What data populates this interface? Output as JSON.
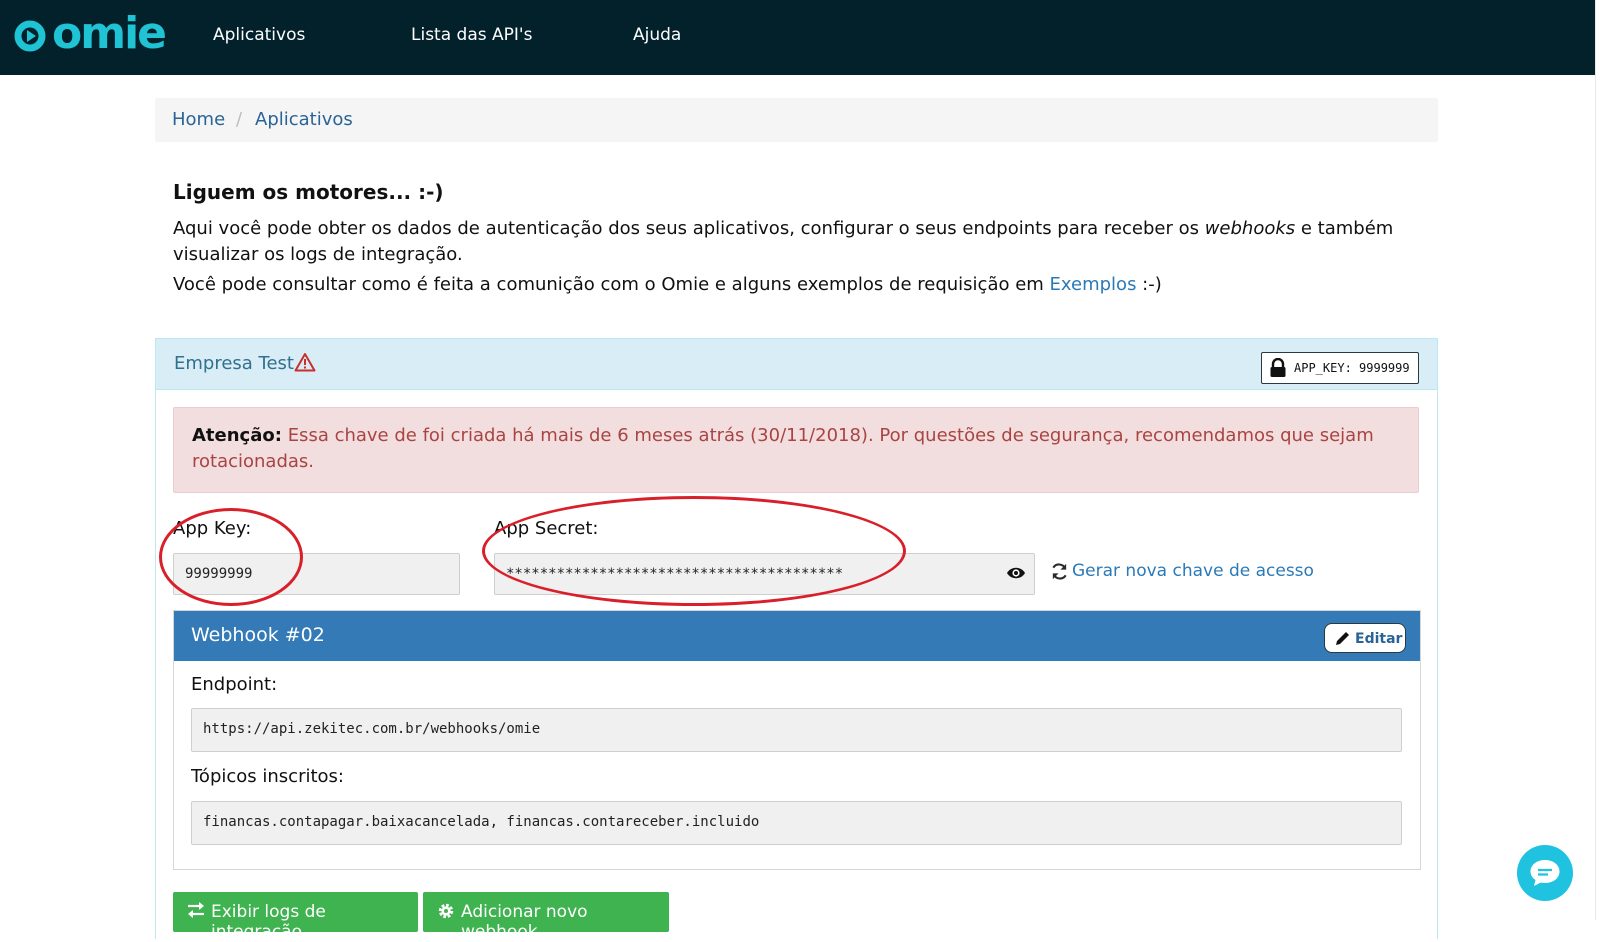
{
  "header": {
    "logo_text": "omie",
    "nav": [
      "Aplicativos",
      "Lista das API's",
      "Ajuda"
    ]
  },
  "breadcrumb": [
    "Home",
    "Aplicativos"
  ],
  "intro": {
    "title": "Liguem os motores... :-)",
    "p1_before": "Aqui você pode obter os dados de autenticação dos seus aplicativos, configurar o seus endpoints para receber os ",
    "p1_em": "webhooks",
    "p1_after": " e também",
    "p1_line2": "visualizar os logs de integração.",
    "p2_before": "Você pode consultar como é feita a comunição com o Omie e alguns exemplos de requisição em ",
    "p2_link": "Exemplos",
    "p2_after": " :-)"
  },
  "panel": {
    "company": "Empresa Test",
    "app_key_badge": "APP_KEY: 9999999",
    "alert_label": "Atenção:",
    "alert_text": "Essa chave de foi criada há mais de 6 meses atrás (30/11/2018). Por questões de segurança, recomendamos que sejam rotacionadas.",
    "app_key_label": "App Key:",
    "app_key_value": "99999999",
    "app_secret_label": "App Secret:",
    "app_secret_value": "****************************************",
    "regen_link": "Gerar nova chave de acesso"
  },
  "webhook": {
    "title": "Webhook #02",
    "edit_label": "Editar",
    "endpoint_label": "Endpoint:",
    "endpoint_value": "https://api.zekitec.com.br/webhooks/omie",
    "topics_label": "Tópicos inscritos:",
    "topics_value": "financas.contapagar.baixacancelada, financas.contareceber.incluido"
  },
  "actions": {
    "logs_button": "Exibir logs de integração",
    "add_button": "Adicionar novo webhook"
  },
  "colors": {
    "topbar": "#02212b",
    "brand": "#1fc3d4",
    "link": "#2a7ab8",
    "webhook_header": "#337ab7",
    "green": "#3fb34f",
    "alert_bg": "#f2dede",
    "annotation": "#d81f2a"
  },
  "icons": [
    "warning-icon",
    "lock-icon",
    "eye-icon",
    "refresh-icon",
    "pencil-icon",
    "exchange-icon",
    "gear-icon",
    "chat-icon"
  ]
}
